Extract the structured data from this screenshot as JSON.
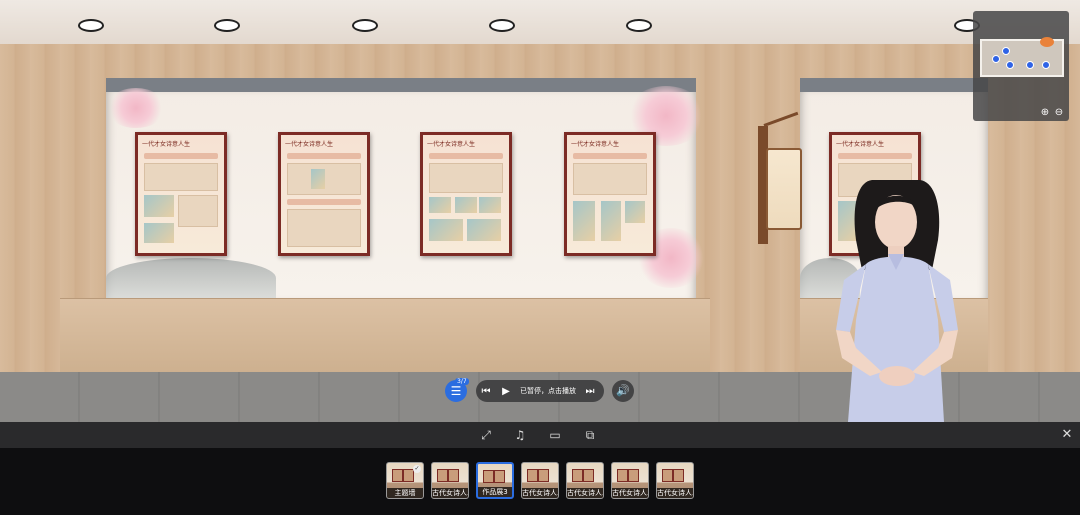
{
  "player": {
    "prev_icon": "⏮",
    "play_icon": "▶",
    "status_text": "已暂停，点击播放",
    "next_icon": "⏭",
    "menu_icon": "☰",
    "menu_badge": "3/7",
    "volume_icon": "🔊"
  },
  "minimap": {
    "zoom_in_icon": "⊕",
    "zoom_out_icon": "⊖"
  },
  "toolbar": {
    "fullscreen_icon": "⤢",
    "music_icon": "♫",
    "vr_icon": "▭",
    "share_icon": "⧉",
    "close_icon": "✕"
  },
  "thumbnails": [
    {
      "label": "主题墙",
      "active": false,
      "checked": true
    },
    {
      "label": "古代女诗人...",
      "active": false,
      "checked": false
    },
    {
      "label": "作品展3",
      "active": true,
      "checked": false
    },
    {
      "label": "古代女诗人...",
      "active": false,
      "checked": false
    },
    {
      "label": "古代女诗人...",
      "active": false,
      "checked": false
    },
    {
      "label": "古代女诗人...",
      "active": false,
      "checked": false
    },
    {
      "label": "古代女诗人...",
      "active": false,
      "checked": false
    }
  ],
  "posters": [
    {
      "title": "一代才女诗意人生"
    },
    {
      "title": "一代才女诗意人生"
    },
    {
      "title": "一代才女诗意人生"
    },
    {
      "title": "一代才女诗意人生"
    },
    {
      "title": "一代才女诗意人生"
    }
  ],
  "colors": {
    "accent": "#2b6de0",
    "poster_frame": "#7c2b25",
    "toolbar_bg": "#2a2a2c"
  }
}
